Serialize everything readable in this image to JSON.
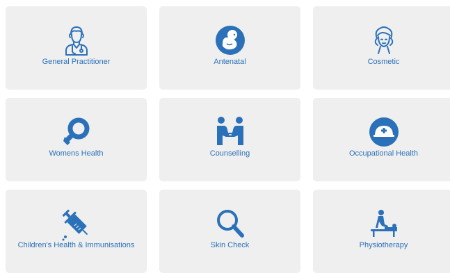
{
  "theme": {
    "tile_bg": "#efefef",
    "accent": "#2b71b9"
  },
  "services": [
    {
      "label": "General Practitioner",
      "icon": "doctor-icon"
    },
    {
      "label": "Antenatal",
      "icon": "fetus-icon"
    },
    {
      "label": "Cosmetic",
      "icon": "woman-face-icon"
    },
    {
      "label": "Womens Health",
      "icon": "female-symbol-icon"
    },
    {
      "label": "Counselling",
      "icon": "two-people-icon"
    },
    {
      "label": "Occupational Health",
      "icon": "hard-hat-icon"
    },
    {
      "label": "Children's Health & Immunisations",
      "icon": "syringe-icon"
    },
    {
      "label": "Skin Check",
      "icon": "magnifier-icon"
    },
    {
      "label": "Physiotherapy",
      "icon": "massage-table-icon"
    }
  ]
}
